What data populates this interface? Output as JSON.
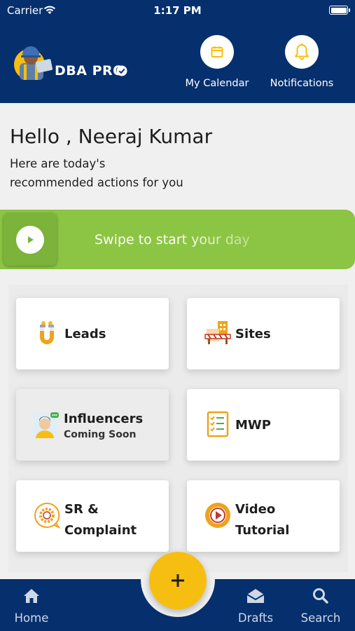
{
  "status_bar": {
    "carrier": "Carrier",
    "time": "1:17 PM"
  },
  "header": {
    "logo_text": "DBA PRO",
    "calendar_label": "My Calendar",
    "notifications_label": "Notifications"
  },
  "greeting": {
    "hello": "Hello , Neeraj Kumar",
    "subtitle_line1": "Here are today's",
    "subtitle_line2": "recommended actions for you"
  },
  "swipe": {
    "label": "Swipe to start your day"
  },
  "tiles": [
    {
      "title": "Leads",
      "subtitle": "",
      "icon": "magnet-icon"
    },
    {
      "title": "Sites",
      "subtitle": "",
      "icon": "construction-site-icon"
    },
    {
      "title": "Influencers",
      "subtitle": "Coming Soon",
      "icon": "influencer-avatar-icon"
    },
    {
      "title": "MWP",
      "subtitle": "",
      "icon": "checklist-icon"
    },
    {
      "title_line1": "SR &",
      "title_line2": "Complaint",
      "icon": "gear-chat-icon"
    },
    {
      "title_line1": "Video",
      "title_line2": "Tutorial",
      "icon": "play-video-icon"
    }
  ],
  "bottom_nav": {
    "home": "Home",
    "drafts": "Drafts",
    "search": "Search",
    "fab_symbol": "+"
  },
  "colors": {
    "primary": "#062f6e",
    "accent_green": "#8cc544",
    "accent_yellow": "#f7be12",
    "icon_orange": "#f0a21c"
  }
}
